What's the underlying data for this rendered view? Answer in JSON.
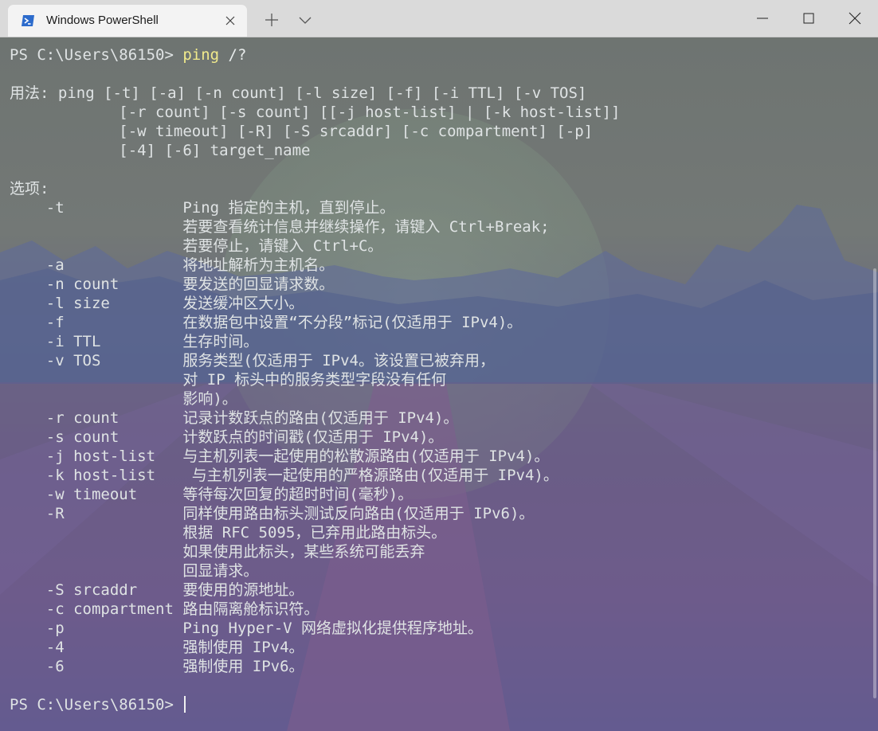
{
  "window": {
    "tab_title": "Windows PowerShell",
    "icons": {
      "tab": "powershell-icon",
      "close_tab": "close-icon",
      "new_tab": "plus-icon",
      "dropdown": "chevron-down-icon",
      "minimize": "minimize-icon",
      "maximize": "maximize-icon",
      "close": "close-icon"
    }
  },
  "terminal": {
    "colors": {
      "text": "#dfe3e4",
      "command": "#f1ea8c",
      "prompt": "#dfe3e4"
    },
    "prompt1": "PS C:\\Users\\86150> ",
    "command": "ping",
    "command_args": " /?",
    "usage_lines": [
      "用法: ping [-t] [-a] [-n count] [-l size] [-f] [-i TTL] [-v TOS]",
      "            [-r count] [-s count] [[-j host-list] | [-k host-list]]",
      "            [-w timeout] [-R] [-S srcaddr] [-c compartment] [-p]",
      "            [-4] [-6] target_name"
    ],
    "options_header": "选项:",
    "options": [
      {
        "flag": "    -t",
        "desc": "Ping 指定的主机，直到停止。"
      },
      {
        "flag": "",
        "desc": "若要查看统计信息并继续操作，请键入 Ctrl+Break;"
      },
      {
        "flag": "",
        "desc": "若要停止，请键入 Ctrl+C。"
      },
      {
        "flag": "    -a",
        "desc": "将地址解析为主机名。"
      },
      {
        "flag": "    -n count",
        "desc": "要发送的回显请求数。"
      },
      {
        "flag": "    -l size",
        "desc": "发送缓冲区大小。"
      },
      {
        "flag": "    -f",
        "desc": "在数据包中设置“不分段”标记(仅适用于 IPv4)。"
      },
      {
        "flag": "    -i TTL",
        "desc": "生存时间。"
      },
      {
        "flag": "    -v TOS",
        "desc": "服务类型(仅适用于 IPv4。该设置已被弃用，"
      },
      {
        "flag": "",
        "desc": "对 IP 标头中的服务类型字段没有任何"
      },
      {
        "flag": "",
        "desc": "影响)。"
      },
      {
        "flag": "    -r count",
        "desc": "记录计数跃点的路由(仅适用于 IPv4)。"
      },
      {
        "flag": "    -s count",
        "desc": "计数跃点的时间戳(仅适用于 IPv4)。"
      },
      {
        "flag": "    -j host-list",
        "desc": "与主机列表一起使用的松散源路由(仅适用于 IPv4)。"
      },
      {
        "flag": "    -k host-list",
        "desc": " 与主机列表一起使用的严格源路由(仅适用于 IPv4)。"
      },
      {
        "flag": "    -w timeout",
        "desc": "等待每次回复的超时时间(毫秒)。"
      },
      {
        "flag": "    -R",
        "desc": "同样使用路由标头测试反向路由(仅适用于 IPv6)。"
      },
      {
        "flag": "",
        "desc": "根据 RFC 5095，已弃用此路由标头。"
      },
      {
        "flag": "",
        "desc": "如果使用此标头，某些系统可能丢弃"
      },
      {
        "flag": "",
        "desc": "回显请求。"
      },
      {
        "flag": "    -S srcaddr",
        "desc": "要使用的源地址。"
      },
      {
        "flag": "    -c compartment",
        "desc": "路由隔离舱标识符。"
      },
      {
        "flag": "    -p",
        "desc": "Ping Hyper-V 网络虚拟化提供程序地址。"
      },
      {
        "flag": "    -4",
        "desc": "强制使用 IPv4。"
      },
      {
        "flag": "    -6",
        "desc": "强制使用 IPv6。"
      }
    ],
    "prompt2": "PS C:\\Users\\86150> "
  }
}
